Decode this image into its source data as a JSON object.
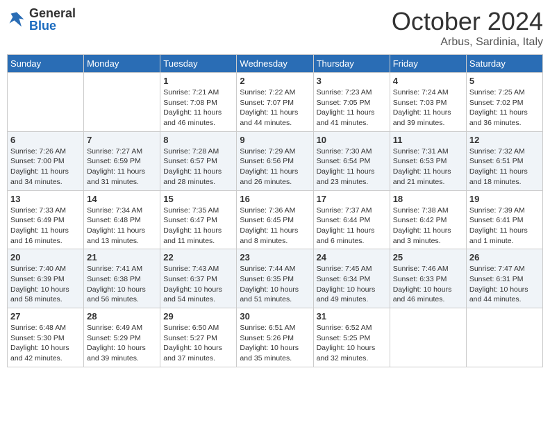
{
  "header": {
    "logo_general": "General",
    "logo_blue": "Blue",
    "month_title": "October 2024",
    "location": "Arbus, Sardinia, Italy"
  },
  "days_of_week": [
    "Sunday",
    "Monday",
    "Tuesday",
    "Wednesday",
    "Thursday",
    "Friday",
    "Saturday"
  ],
  "weeks": [
    [
      {
        "num": "",
        "info": ""
      },
      {
        "num": "",
        "info": ""
      },
      {
        "num": "1",
        "info": "Sunrise: 7:21 AM\nSunset: 7:08 PM\nDaylight: 11 hours and 46 minutes."
      },
      {
        "num": "2",
        "info": "Sunrise: 7:22 AM\nSunset: 7:07 PM\nDaylight: 11 hours and 44 minutes."
      },
      {
        "num": "3",
        "info": "Sunrise: 7:23 AM\nSunset: 7:05 PM\nDaylight: 11 hours and 41 minutes."
      },
      {
        "num": "4",
        "info": "Sunrise: 7:24 AM\nSunset: 7:03 PM\nDaylight: 11 hours and 39 minutes."
      },
      {
        "num": "5",
        "info": "Sunrise: 7:25 AM\nSunset: 7:02 PM\nDaylight: 11 hours and 36 minutes."
      }
    ],
    [
      {
        "num": "6",
        "info": "Sunrise: 7:26 AM\nSunset: 7:00 PM\nDaylight: 11 hours and 34 minutes."
      },
      {
        "num": "7",
        "info": "Sunrise: 7:27 AM\nSunset: 6:59 PM\nDaylight: 11 hours and 31 minutes."
      },
      {
        "num": "8",
        "info": "Sunrise: 7:28 AM\nSunset: 6:57 PM\nDaylight: 11 hours and 28 minutes."
      },
      {
        "num": "9",
        "info": "Sunrise: 7:29 AM\nSunset: 6:56 PM\nDaylight: 11 hours and 26 minutes."
      },
      {
        "num": "10",
        "info": "Sunrise: 7:30 AM\nSunset: 6:54 PM\nDaylight: 11 hours and 23 minutes."
      },
      {
        "num": "11",
        "info": "Sunrise: 7:31 AM\nSunset: 6:53 PM\nDaylight: 11 hours and 21 minutes."
      },
      {
        "num": "12",
        "info": "Sunrise: 7:32 AM\nSunset: 6:51 PM\nDaylight: 11 hours and 18 minutes."
      }
    ],
    [
      {
        "num": "13",
        "info": "Sunrise: 7:33 AM\nSunset: 6:49 PM\nDaylight: 11 hours and 16 minutes."
      },
      {
        "num": "14",
        "info": "Sunrise: 7:34 AM\nSunset: 6:48 PM\nDaylight: 11 hours and 13 minutes."
      },
      {
        "num": "15",
        "info": "Sunrise: 7:35 AM\nSunset: 6:47 PM\nDaylight: 11 hours and 11 minutes."
      },
      {
        "num": "16",
        "info": "Sunrise: 7:36 AM\nSunset: 6:45 PM\nDaylight: 11 hours and 8 minutes."
      },
      {
        "num": "17",
        "info": "Sunrise: 7:37 AM\nSunset: 6:44 PM\nDaylight: 11 hours and 6 minutes."
      },
      {
        "num": "18",
        "info": "Sunrise: 7:38 AM\nSunset: 6:42 PM\nDaylight: 11 hours and 3 minutes."
      },
      {
        "num": "19",
        "info": "Sunrise: 7:39 AM\nSunset: 6:41 PM\nDaylight: 11 hours and 1 minute."
      }
    ],
    [
      {
        "num": "20",
        "info": "Sunrise: 7:40 AM\nSunset: 6:39 PM\nDaylight: 10 hours and 58 minutes."
      },
      {
        "num": "21",
        "info": "Sunrise: 7:41 AM\nSunset: 6:38 PM\nDaylight: 10 hours and 56 minutes."
      },
      {
        "num": "22",
        "info": "Sunrise: 7:43 AM\nSunset: 6:37 PM\nDaylight: 10 hours and 54 minutes."
      },
      {
        "num": "23",
        "info": "Sunrise: 7:44 AM\nSunset: 6:35 PM\nDaylight: 10 hours and 51 minutes."
      },
      {
        "num": "24",
        "info": "Sunrise: 7:45 AM\nSunset: 6:34 PM\nDaylight: 10 hours and 49 minutes."
      },
      {
        "num": "25",
        "info": "Sunrise: 7:46 AM\nSunset: 6:33 PM\nDaylight: 10 hours and 46 minutes."
      },
      {
        "num": "26",
        "info": "Sunrise: 7:47 AM\nSunset: 6:31 PM\nDaylight: 10 hours and 44 minutes."
      }
    ],
    [
      {
        "num": "27",
        "info": "Sunrise: 6:48 AM\nSunset: 5:30 PM\nDaylight: 10 hours and 42 minutes."
      },
      {
        "num": "28",
        "info": "Sunrise: 6:49 AM\nSunset: 5:29 PM\nDaylight: 10 hours and 39 minutes."
      },
      {
        "num": "29",
        "info": "Sunrise: 6:50 AM\nSunset: 5:27 PM\nDaylight: 10 hours and 37 minutes."
      },
      {
        "num": "30",
        "info": "Sunrise: 6:51 AM\nSunset: 5:26 PM\nDaylight: 10 hours and 35 minutes."
      },
      {
        "num": "31",
        "info": "Sunrise: 6:52 AM\nSunset: 5:25 PM\nDaylight: 10 hours and 32 minutes."
      },
      {
        "num": "",
        "info": ""
      },
      {
        "num": "",
        "info": ""
      }
    ]
  ]
}
